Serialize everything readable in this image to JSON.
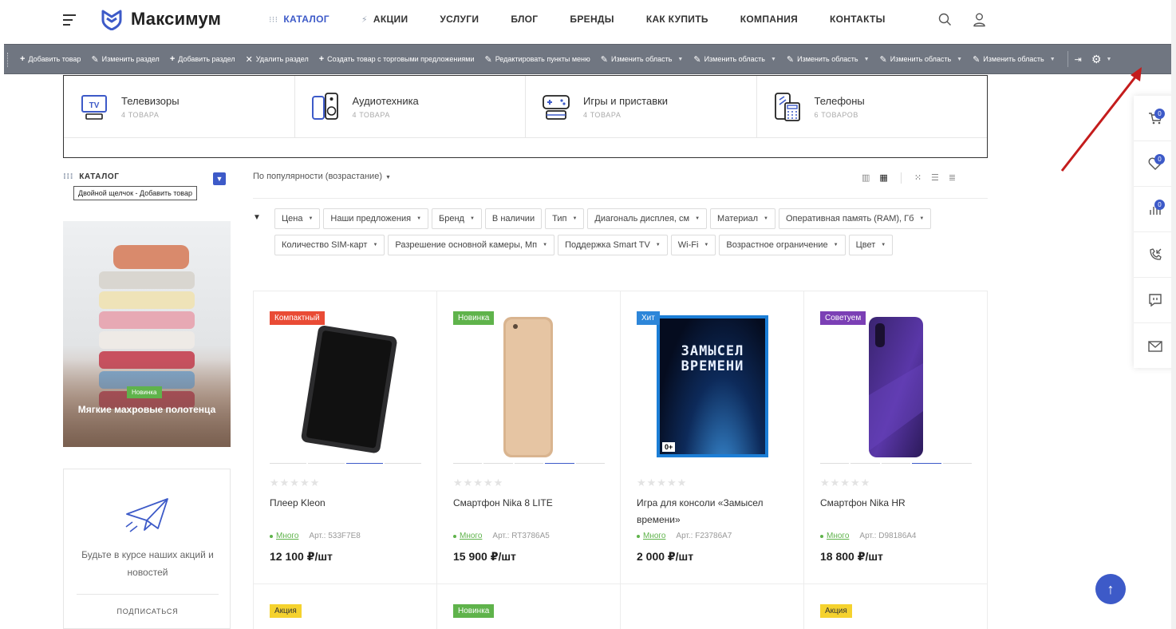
{
  "header": {
    "logo": "Максимум",
    "nav": [
      {
        "label": "КАТАЛОГ",
        "active": true,
        "icon": "grid-dots-icon"
      },
      {
        "label": "АКЦИИ",
        "active": false,
        "icon": "bolt-icon"
      },
      {
        "label": "УСЛУГИ",
        "active": false
      },
      {
        "label": "БЛОГ",
        "active": false
      },
      {
        "label": "БРЕНДЫ",
        "active": false
      },
      {
        "label": "КАК КУПИТЬ",
        "active": false
      },
      {
        "label": "КОМПАНИЯ",
        "active": false
      },
      {
        "label": "КОНТАКТЫ",
        "active": false
      }
    ]
  },
  "adminbar": {
    "buttons": [
      {
        "icon": "+",
        "label": "Добавить товар",
        "caret": false
      },
      {
        "icon": "✎",
        "label": "Изменить раздел",
        "caret": false
      },
      {
        "icon": "+",
        "label": "Добавить раздел",
        "caret": false
      },
      {
        "icon": "✕",
        "label": "Удалить раздел",
        "caret": false
      },
      {
        "icon": "+",
        "label": "Создать товар с торговыми предложениями",
        "caret": false
      },
      {
        "icon": "✎",
        "label": "Редактировать пункты меню",
        "caret": false
      },
      {
        "icon": "✎",
        "label": "Изменить область",
        "caret": true
      },
      {
        "icon": "✎",
        "label": "Изменить область",
        "caret": true
      },
      {
        "icon": "✎",
        "label": "Изменить область",
        "caret": true
      },
      {
        "icon": "✎",
        "label": "Изменить область",
        "caret": true
      },
      {
        "icon": "✎",
        "label": "Изменить область",
        "caret": true
      }
    ]
  },
  "categories": [
    {
      "name": "Телевизоры",
      "count": "4 ТОВАРА",
      "icon": "tv-icon"
    },
    {
      "name": "Аудиотехника",
      "count": "4 ТОВАРА",
      "icon": "speakers-icon"
    },
    {
      "name": "Игры и приставки",
      "count": "4 ТОВАРА",
      "icon": "gamepad-icon"
    },
    {
      "name": "Телефоны",
      "count": "6 ТОВАРОВ",
      "icon": "phone-icon"
    }
  ],
  "sidebar": {
    "title": "КАТАЛОГ",
    "tooltip": "Двойной щелчок - Добавить товар",
    "promo": {
      "badge": "Новинка",
      "title": "Мягкие махровые полотенца"
    },
    "subscribe": {
      "text": "Будьте в курсе наших акций и новостей",
      "button": "ПОДПИСАТЬСЯ"
    }
  },
  "sort": {
    "label": "По популярности (возрастание)"
  },
  "filters": [
    "Цена",
    "Наши предложения",
    "Бренд",
    "В наличии",
    "Тип",
    "Диагональ дисплея, см",
    "Материал",
    "Оперативная память (RAM), Гб",
    "Количество SIM-карт",
    "Разрешение основной камеры, Мп",
    "Поддержка Smart TV",
    "Wi-Fi",
    "Возрастное ограничение",
    "Цвет"
  ],
  "products": [
    {
      "label": "Компактный",
      "label_color": "#e94b35",
      "name": "Плеер Kleon",
      "stock": "Много",
      "sku": "Арт.: 533F7E8",
      "price": "12 100 ₽/шт"
    },
    {
      "label": "Новинка",
      "label_color": "#5fb34b",
      "name": "Смартфон Nika 8 LITE",
      "stock": "Много",
      "sku": "Арт.: RT3786A5",
      "price": "15 900 ₽/шт"
    },
    {
      "label": "Хит",
      "label_color": "#2d86d9",
      "name": "Игра для консоли «Замысел времени»",
      "stock": "Много",
      "sku": "Арт.: F23786A7",
      "price": "2 000 ₽/шт"
    },
    {
      "label": "Советуем",
      "label_color": "#7b3fb5",
      "name": "Смартфон Nika HR",
      "stock": "Много",
      "sku": "Арт.: D98186A4",
      "price": "18 800 ₽/шт"
    }
  ],
  "products_row2": [
    {
      "label": "Акция",
      "label_color": "#f5d22e"
    },
    {
      "label": "Новинка",
      "label_color": "#5fb34b"
    },
    {
      "label": "",
      "label_color": ""
    },
    {
      "label": "Акция",
      "label_color": "#f5d22e"
    }
  ],
  "game_cover": {
    "title": "ЗАМЫСЕЛ ВРЕМЕНИ",
    "age": "0+"
  },
  "right_panel": {
    "cart_count": "0",
    "favorites_count": "0",
    "compare_count": "0"
  },
  "colors": {
    "accent": "#3d5ac8",
    "adminbar": "#707681"
  }
}
